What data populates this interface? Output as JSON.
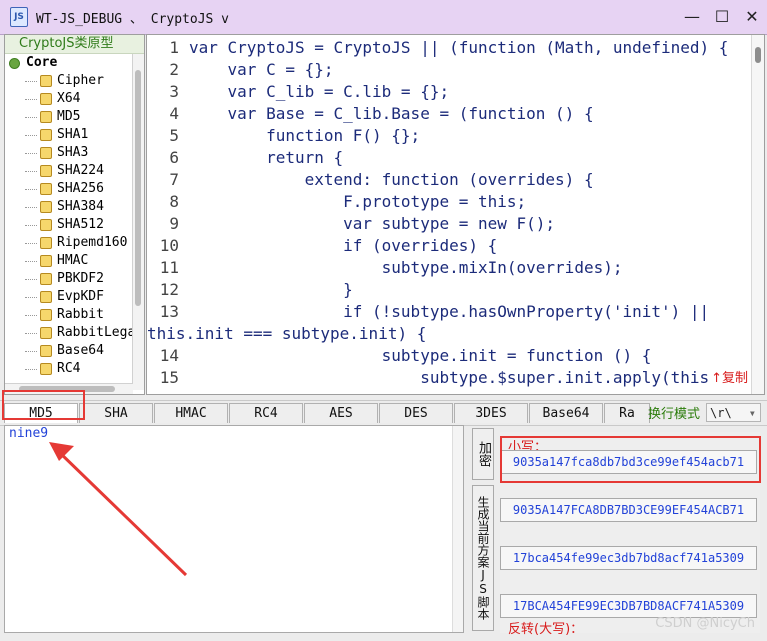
{
  "window": {
    "title": "WT-JS_DEBUG 、 CryptoJS v",
    "icon": "js-icon",
    "controls": {
      "minimize": "—",
      "maximize": "☐",
      "close": "✕"
    }
  },
  "sidebar": {
    "header": "CryptoJS类原型",
    "root": "Core",
    "items": [
      "Cipher",
      "X64",
      "MD5",
      "SHA1",
      "SHA3",
      "SHA224",
      "SHA256",
      "SHA384",
      "SHA512",
      "Ripemd160",
      "HMAC",
      "PBKDF2",
      "EvpKDF",
      "Rabbit",
      "RabbitLegac",
      "Base64",
      "RC4"
    ]
  },
  "editor": {
    "lines": [
      {
        "num": "1",
        "text": "var CryptoJS = CryptoJS || (function (Math, undefined) {"
      },
      {
        "num": "2",
        "text": "    var C = {};"
      },
      {
        "num": "3",
        "text": "    var C_lib = C.lib = {};"
      },
      {
        "num": "4",
        "text": "    var Base = C_lib.Base = (function () {"
      },
      {
        "num": "5",
        "text": "        function F() {};"
      },
      {
        "num": "6",
        "text": "        return {"
      },
      {
        "num": "7",
        "text": "            extend: function (overrides) {"
      },
      {
        "num": "8",
        "text": "                F.prototype = this;"
      },
      {
        "num": "9",
        "text": "                var subtype = new F();"
      },
      {
        "num": "10",
        "text": "                if (overrides) {"
      },
      {
        "num": "11",
        "text": "                    subtype.mixIn(overrides);"
      },
      {
        "num": "12",
        "text": "                }"
      },
      {
        "num": "13",
        "text": "                if (!subtype.hasOwnProperty('init') ||"
      },
      {
        "num": "",
        "text": "this.init === subtype.init) {"
      },
      {
        "num": "14",
        "text": "                    subtype.init = function () {"
      },
      {
        "num": "15",
        "text": "                        subtype.$super.init.apply(this"
      }
    ],
    "floating_label": "↑复制"
  },
  "tabs": [
    {
      "label": "MD5",
      "active": true
    },
    {
      "label": "SHA",
      "active": false
    },
    {
      "label": "HMAC",
      "active": false
    },
    {
      "label": "RC4",
      "active": false
    },
    {
      "label": "AES",
      "active": false
    },
    {
      "label": "DES",
      "active": false
    },
    {
      "label": "3DES",
      "active": false
    },
    {
      "label": "Base64",
      "active": false
    },
    {
      "label": "Ra",
      "active": false
    }
  ],
  "mode": {
    "label": "换行模式",
    "selected": "\\r\\"
  },
  "input": {
    "value": "nine9"
  },
  "actions": {
    "encrypt_label": "加密",
    "generate_script_label": "生成当前方案JS脚本"
  },
  "outputs": {
    "lower_label": "小写：",
    "lower_value": "9035a147fca8db7bd3ce99ef454acb71",
    "upper_value": "9035A147FCA8DB7BD3CE99EF454ACB71",
    "reverse_lower_value": "17bca454fe99ec3db7bd8acf741a5309",
    "reverse_upper_value": "17BCA454FE99EC3DB7BD8ACF741A5309",
    "reverse_upper_label": "反转(大写)："
  },
  "watermark": "CSDN @NicyCh",
  "colors": {
    "title_bg": "#E7D3F3",
    "accent_red": "#E53935",
    "code_keyword": "#1543D8",
    "tree_header": "#2F7B1A"
  }
}
